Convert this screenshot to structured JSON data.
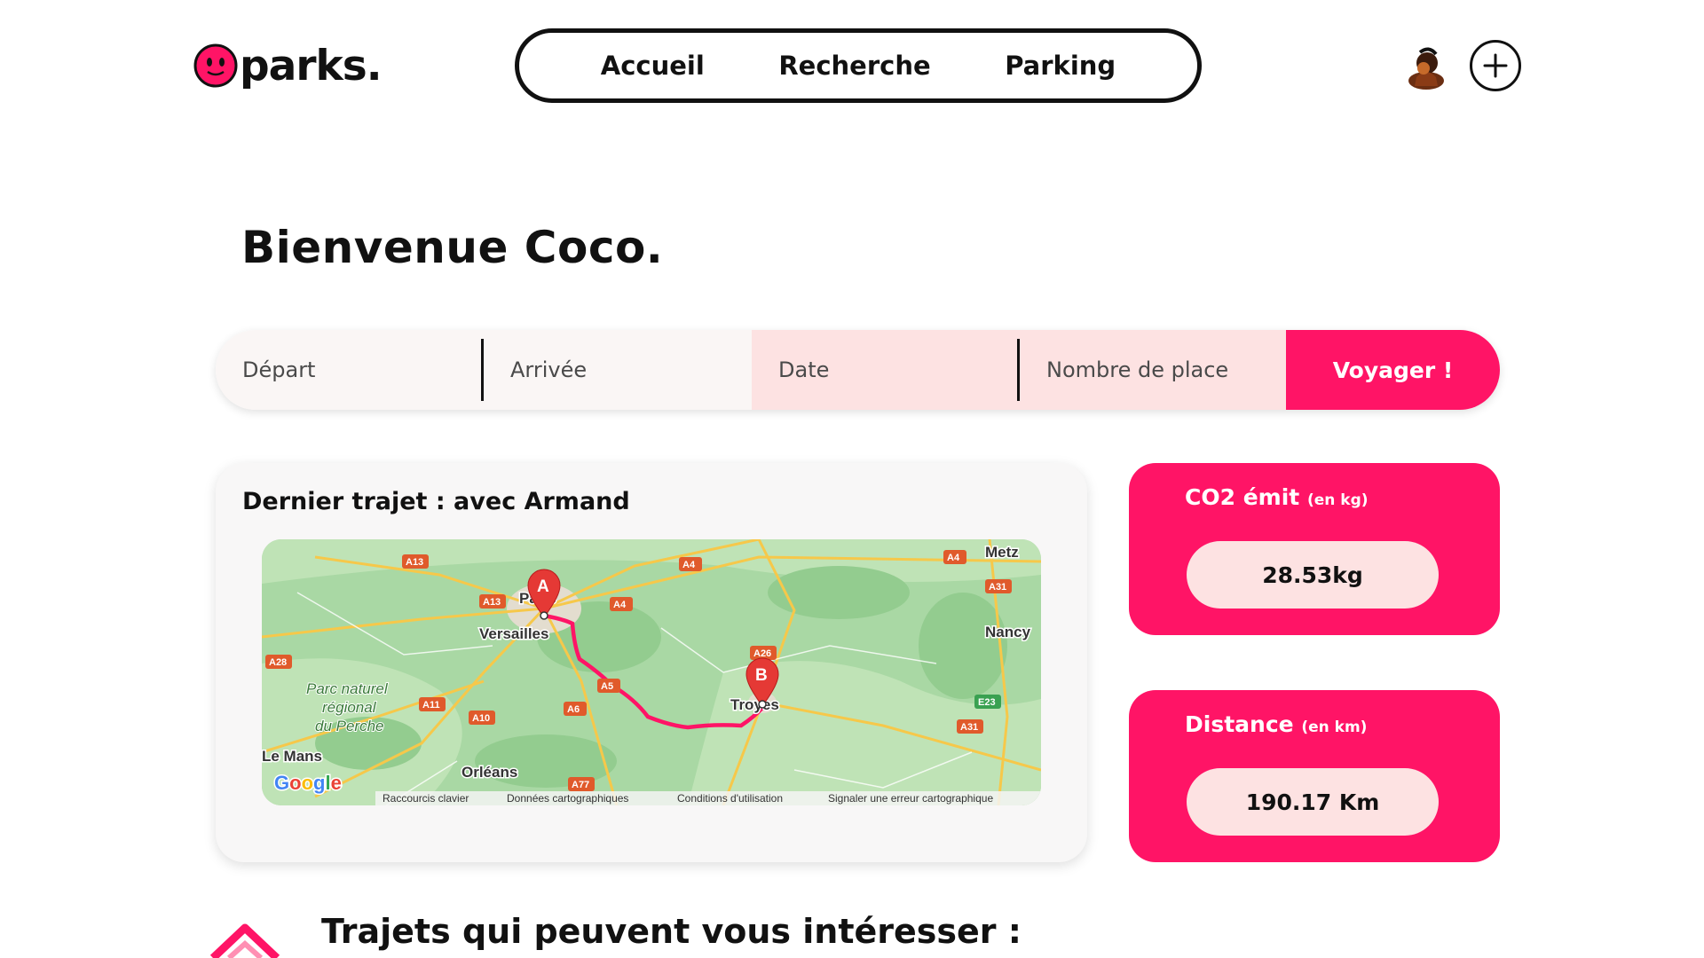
{
  "header": {
    "logo_text": "parks.",
    "nav": [
      "Accueil",
      "Recherche",
      "Parking"
    ],
    "avatar_icon": "user-avatar",
    "add_icon": "plus-icon"
  },
  "welcome": "Bienvenue Coco.",
  "search": {
    "depart_placeholder": "Départ",
    "arrivee_placeholder": "Arrivée",
    "date_placeholder": "Date",
    "places_placeholder": "Nombre de place",
    "submit_label": "Voyager !"
  },
  "last_trip": {
    "title": "Dernier trajet : avec Armand",
    "map": {
      "marker_a": "A",
      "marker_b": "B",
      "cities": [
        "Metz",
        "Paris",
        "Versailles",
        "Nancy",
        "Troyes",
        "Le Mans",
        "Orléans"
      ],
      "region_label": "Parc naturel régional du Perche",
      "roads": [
        "A13",
        "A4",
        "A13",
        "A4",
        "A31",
        "A28",
        "A26",
        "A5",
        "A11",
        "A10",
        "A6",
        "E23",
        "A31",
        "A77"
      ],
      "brand": "Google",
      "footer": [
        "Raccourcis clavier",
        "Données cartographiques",
        "Conditions d'utilisation",
        "Signaler une erreur cartographique"
      ]
    }
  },
  "stats": {
    "co2": {
      "title": "CO2 émit",
      "unit": "(en kg)",
      "value": "28.53kg"
    },
    "distance": {
      "title": "Distance",
      "unit": "(en km)",
      "value": "190.17 Km"
    }
  },
  "suggestions": {
    "title": "Trajets qui peuvent vous intéresser :"
  },
  "colors": {
    "accent": "#ff1466",
    "soft_pink": "#fde2e2",
    "light": "#faf6f5"
  }
}
